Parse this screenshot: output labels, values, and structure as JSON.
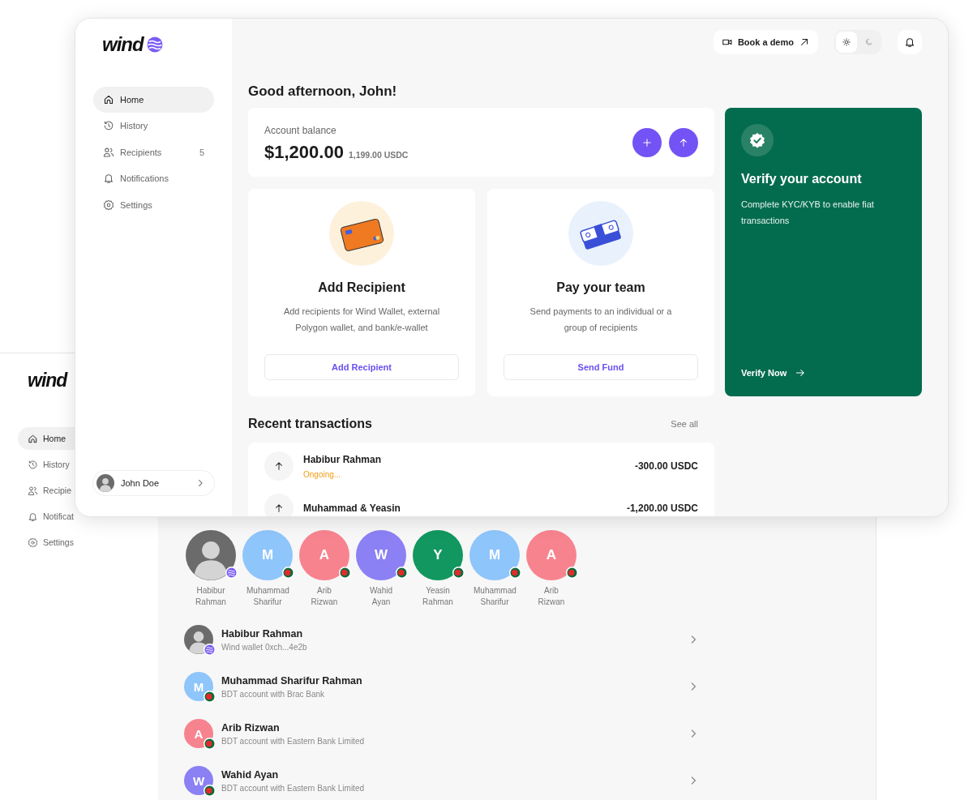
{
  "back_window": {
    "logo": "wind",
    "nav": [
      {
        "kind": "home",
        "label": "Home",
        "selected": true
      },
      {
        "kind": "history",
        "label": "History",
        "selected": false
      },
      {
        "kind": "recipients",
        "label": "Recipie",
        "selected": false
      },
      {
        "kind": "notifications",
        "label": "Notificat",
        "selected": false
      },
      {
        "kind": "settings",
        "label": "Settings",
        "selected": false
      }
    ],
    "recent_recipients": [
      {
        "name": "Habibur Rahman",
        "kind": "photo",
        "badge": {
          "kind": "wallet"
        }
      },
      {
        "name": "Muhammad Sharifur",
        "kind": "initial",
        "initial": "M",
        "color": "#8ec5fb",
        "badge": {
          "kind": "flag"
        }
      },
      {
        "name": "Arib Rizwan",
        "kind": "initial",
        "initial": "A",
        "color": "#f7838f",
        "badge": {
          "kind": "flag"
        }
      },
      {
        "name": "Wahid Ayan",
        "kind": "initial",
        "initial": "W",
        "color": "#8b80f4",
        "badge": {
          "kind": "flag"
        }
      },
      {
        "name": "Yeasin Rahman",
        "kind": "initial",
        "initial": "Y",
        "color": "#11975f",
        "badge": {
          "kind": "flag"
        }
      },
      {
        "name": "Muhammad Sharifur",
        "kind": "initial",
        "initial": "M",
        "color": "#8ec5fb",
        "badge": {
          "kind": "flag"
        }
      },
      {
        "name": "Arib Rizwan",
        "kind": "initial",
        "initial": "A",
        "color": "#f7838f",
        "badge": {
          "kind": "flag"
        }
      }
    ],
    "recipients": [
      {
        "name": "Habibur Rahman",
        "detail": "Wind wallet 0xch...4e2b",
        "kind": "photo",
        "badge": {
          "kind": "wallet"
        }
      },
      {
        "name": "Muhammad Sharifur Rahman",
        "detail": "BDT account with Brac Bank",
        "kind": "initial",
        "initial": "M",
        "color": "#8ec5fb",
        "badge": {
          "kind": "flag"
        }
      },
      {
        "name": "Arib Rizwan",
        "detail": "BDT account with Eastern Bank Limited",
        "kind": "initial",
        "initial": "A",
        "color": "#f7838f",
        "badge": {
          "kind": "flag"
        }
      },
      {
        "name": "Wahid Ayan",
        "detail": "BDT account with Eastern Bank Limited",
        "kind": "initial",
        "initial": "W",
        "color": "#8b80f4",
        "badge": {
          "kind": "flag"
        }
      }
    ]
  },
  "front_window": {
    "logo": "wind",
    "nav": [
      {
        "kind": "home",
        "label": "Home",
        "selected": true
      },
      {
        "kind": "history",
        "label": "History",
        "selected": false
      },
      {
        "kind": "recipients",
        "label": "Recipients",
        "count": "5",
        "selected": false
      },
      {
        "kind": "notifications",
        "label": "Notifications",
        "selected": false
      },
      {
        "kind": "settings",
        "label": "Settings",
        "selected": false
      }
    ],
    "user": {
      "name": "John Doe"
    },
    "topbar": {
      "demo_button": "Book a demo",
      "theme_options": [
        {
          "kind": "light",
          "selected": true
        },
        {
          "kind": "dark",
          "selected": false
        }
      ]
    },
    "greeting": "Good afternoon, John!",
    "balance": {
      "label": "Account balance",
      "amount": "$1,200.00",
      "secondary": "1,199.00 USDC"
    },
    "actions": [
      {
        "kind": "card",
        "title": "Add Recipient",
        "description": "Add recipients for Wind Wallet, external Polygon wallet, and bank/e-wallet",
        "button": "Add Recipient"
      },
      {
        "kind": "cash",
        "title": "Pay your team",
        "description": "Send payments to an individual or a group of recipients",
        "button": "Send Fund"
      }
    ],
    "verify": {
      "title": "Verify your account",
      "description": "Complete KYC/KYB to enable fiat transactions",
      "action": "Verify Now"
    },
    "transactions": {
      "title": "Recent transactions",
      "see_all": "See all",
      "rows": [
        {
          "name": "Habibur Rahman",
          "status": {
            "text": "Ongoing...",
            "color": "#f29d12"
          },
          "amount": "-300.00 USDC"
        },
        {
          "name": "Muhammad & Yeasin",
          "amount": "-1,200.00 USDC"
        }
      ]
    }
  }
}
